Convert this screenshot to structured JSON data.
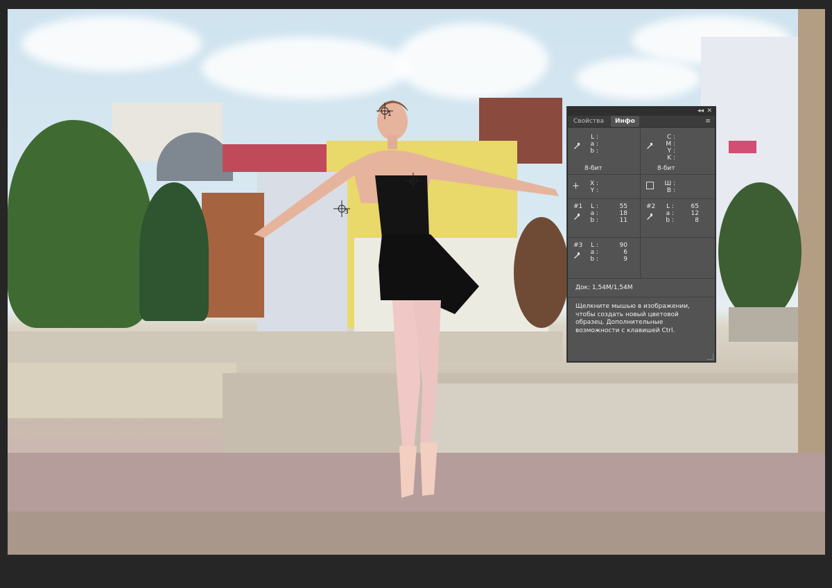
{
  "panel": {
    "tabs": [
      {
        "label": "Свойства"
      },
      {
        "label": "Инфо"
      }
    ],
    "collapse_glyph": "◂◂",
    "close_glyph": "✕",
    "menu_glyph": "≡",
    "rgb_block": {
      "labels": [
        "L :",
        "a :",
        "b :"
      ],
      "mode": "8-бит"
    },
    "cmyk_block": {
      "labels": [
        "C :",
        "M :",
        "Y :",
        "K :"
      ],
      "mode": "8-бит"
    },
    "xy_block": {
      "labels": [
        "X :",
        "Y :"
      ]
    },
    "wh_block": {
      "labels": [
        "Ш :",
        "В :"
      ]
    },
    "samplers": [
      {
        "id": "#1",
        "labels": [
          "L :",
          "a :",
          "b :"
        ],
        "values": [
          "55",
          "18",
          "11"
        ]
      },
      {
        "id": "#2",
        "labels": [
          "L :",
          "a :",
          "b :"
        ],
        "values": [
          "65",
          "12",
          "8"
        ]
      },
      {
        "id": "#3",
        "labels": [
          "L :",
          "a :",
          "b :"
        ],
        "values": [
          "90",
          "6",
          "9"
        ]
      }
    ],
    "doc_size": "Док: 1,54M/1,54M",
    "hint": "Щелкните мышью в изображении, чтобы создать новый цветовой образец. Дополнительные возможности с клавишей Ctrl."
  },
  "markers": [
    {
      "n": "1"
    },
    {
      "n": "2"
    },
    {
      "n": "3"
    }
  ],
  "colors": {
    "panel_bg": "#535353",
    "panel_header": "#3c3c3c",
    "panel_text": "#ededed",
    "workspace": "#262626"
  }
}
